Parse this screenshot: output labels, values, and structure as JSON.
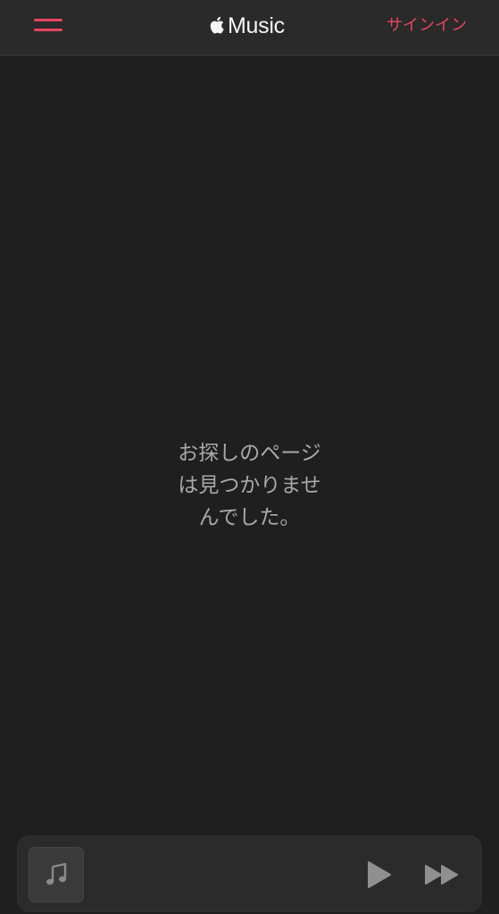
{
  "header": {
    "menu_icon": "hamburger-menu-icon",
    "logo_icon": "apple-logo-icon",
    "logo_text": "Music",
    "signin_label": "サインイン",
    "accent_color": "#e8455c"
  },
  "main": {
    "message_lines": [
      "お探しのページ",
      "は見つかりませ",
      "んでした。"
    ]
  },
  "player": {
    "artwork_icon": "music-note-icon",
    "play_icon": "play-icon",
    "next_icon": "fast-forward-icon"
  },
  "colors": {
    "background": "#1f1f1f",
    "header_background": "#2a2a2a",
    "player_background": "#2b2b2b"
  }
}
